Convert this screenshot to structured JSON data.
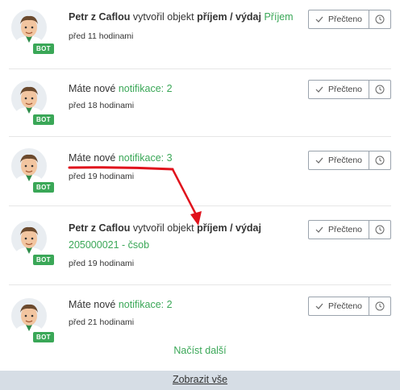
{
  "notifications": [
    {
      "bold_name": "Petr z Caflou",
      "middle": " vytvořil objekt ",
      "bold_object": "příjem / výdaj",
      "link": "Příjem",
      "time": "před 11 hodinami",
      "badge": "BOT"
    },
    {
      "prefix": "Máte nové ",
      "link": "notifikace: 2",
      "time": "před 18 hodinami",
      "badge": "BOT"
    },
    {
      "prefix": "Máte nové ",
      "link": "notifikace: 3",
      "time": "před 19 hodinami",
      "badge": "BOT"
    },
    {
      "bold_name": "Petr z Caflou",
      "middle": " vytvořil objekt ",
      "bold_object": "příjem / výdaj",
      "link": "205000021 - čsob",
      "time": "před 19 hodinami",
      "badge": "BOT"
    },
    {
      "prefix": "Máte nové ",
      "link": "notifikace: 2",
      "time": "před 21 hodinami",
      "badge": "BOT"
    }
  ],
  "actions": {
    "read_label": "Přečteno",
    "check_icon": "check-icon",
    "clock_icon": "clock-icon"
  },
  "load_more": "Načíst další",
  "footer": {
    "show_all": "Zobrazit vše"
  },
  "colors": {
    "accent": "#3aa757",
    "annotation": "#e0121c",
    "footer_bg": "#d6dde5"
  }
}
